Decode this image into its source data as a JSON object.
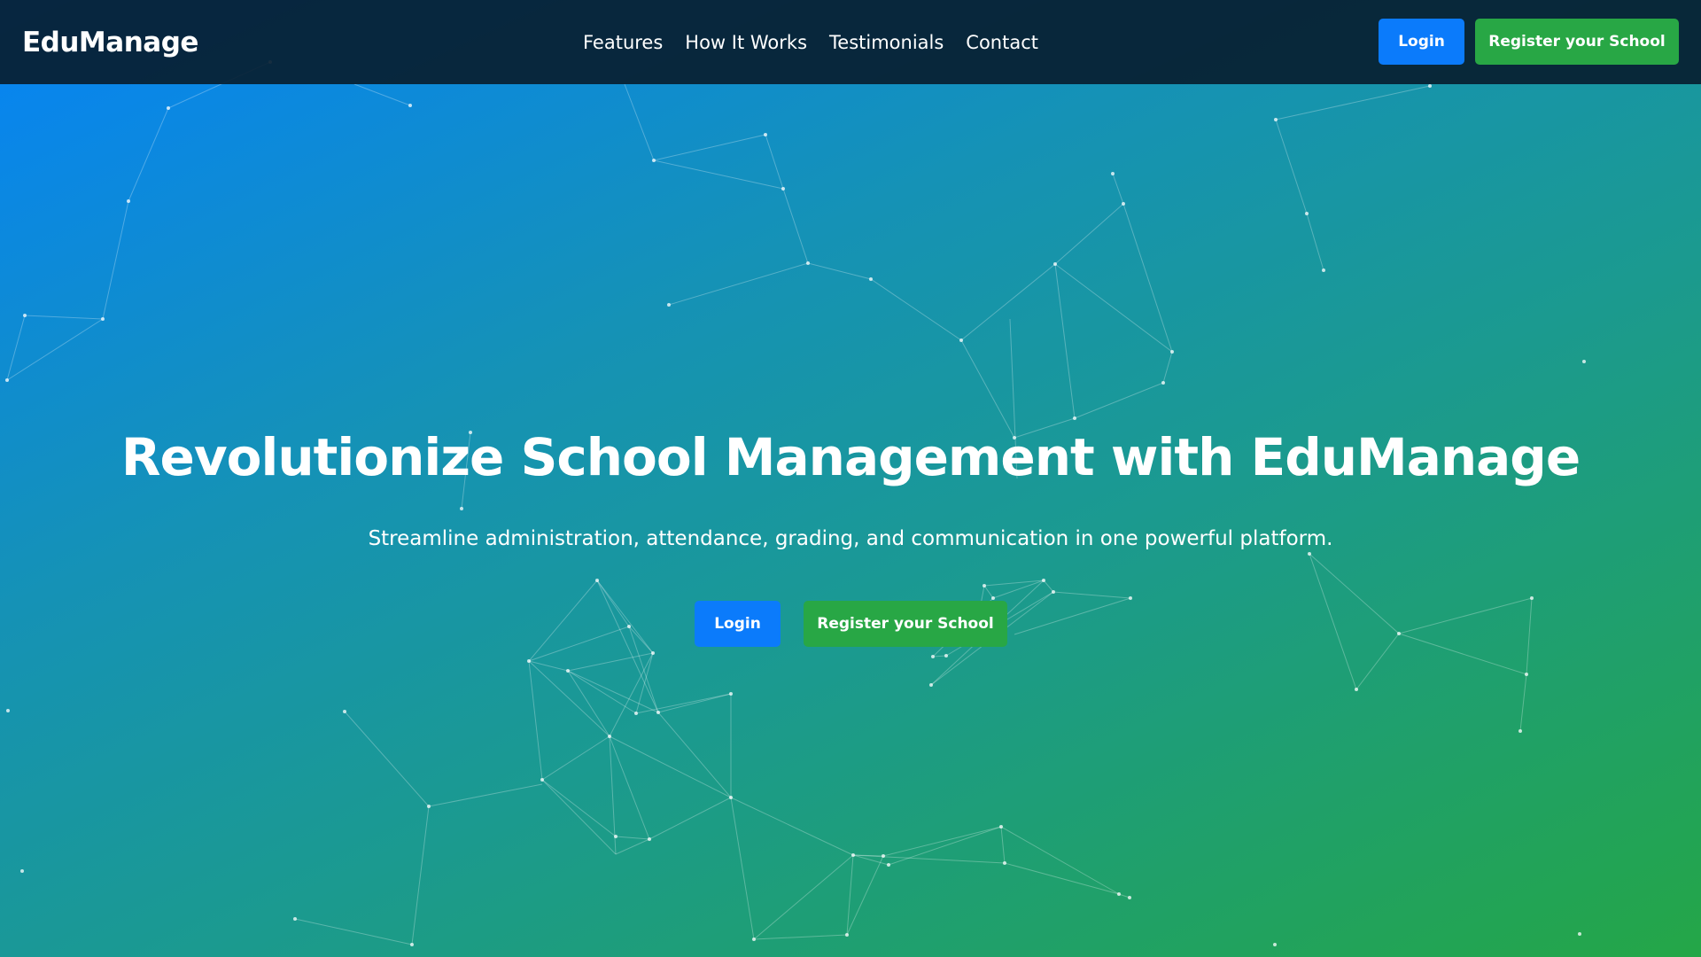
{
  "header": {
    "brand": "EduManage",
    "nav": [
      "Features",
      "How It Works",
      "Testimonials",
      "Contact"
    ],
    "login_label": "Login",
    "register_label": "Register your School"
  },
  "hero": {
    "title": "Revolutionize School Management with EduManage",
    "subtitle": "Streamline administration, attendance, grading, and communication in one powerful platform.",
    "login_label": "Login",
    "register_label": "Register your School"
  },
  "colors": {
    "primary_blue": "#0b7bfb",
    "success_green": "#28a745",
    "navbar_bg": "#081e30",
    "gradient_start": "#0683f7",
    "gradient_end": "#24a647"
  }
}
